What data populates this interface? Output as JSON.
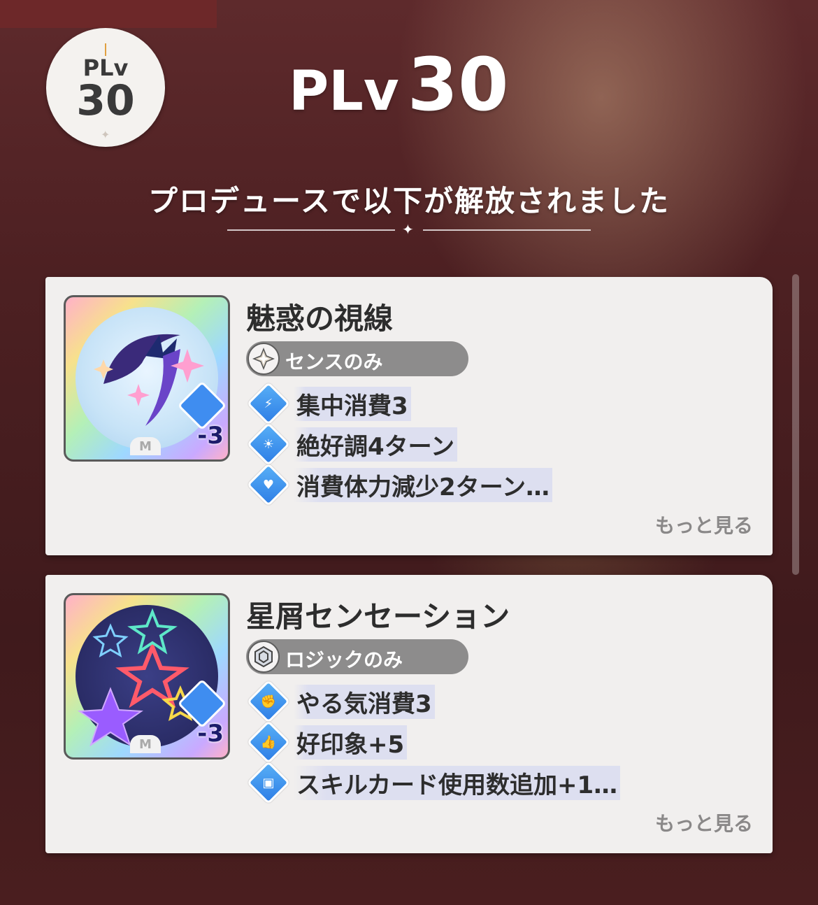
{
  "header": {
    "badge_plv": "PLv",
    "badge_level": "30",
    "level_prefix": "PLv",
    "level_number": "30",
    "subtitle": "プロデュースで以下が解放されました"
  },
  "cards": [
    {
      "title": "魅惑の視線",
      "plan": "センスのみ",
      "cost": "-3",
      "rarity": "M",
      "effects": [
        {
          "icon": "focus-icon",
          "text": "集中消費3"
        },
        {
          "icon": "good-condition-icon",
          "text": "絶好調4ターン"
        },
        {
          "icon": "stamina-reduction-icon",
          "text": "消費体力減少2ターン…"
        }
      ],
      "more_label": "もっと見る"
    },
    {
      "title": "星屑センセーション",
      "plan": "ロジックのみ",
      "cost": "-3",
      "rarity": "M",
      "effects": [
        {
          "icon": "motivation-icon",
          "text": "やる気消費3"
        },
        {
          "icon": "good-impression-icon",
          "text": "好印象+5"
        },
        {
          "icon": "skill-card-use-icon",
          "text": "スキルカード使用数追加+1…"
        }
      ],
      "more_label": "もっと見る"
    }
  ],
  "colors": {
    "card_bg": "#f1efee",
    "pill_bg": "#8d8c8c",
    "effect_gem": "#3f8df0",
    "background": "#4a1c1e"
  }
}
